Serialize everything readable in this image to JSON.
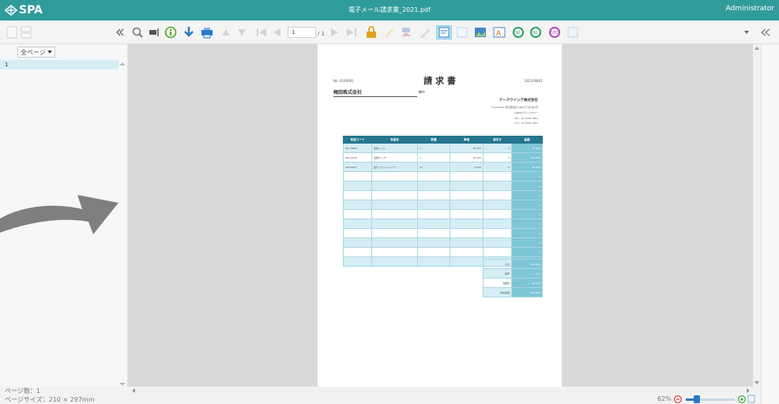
{
  "app": {
    "logo_text": "SPA",
    "document_title": "電子メール請求書_2021.pdf",
    "user": "Administrator"
  },
  "toolbar": {
    "page_input": "1",
    "page_total": "/ 1"
  },
  "sidebar": {
    "page_select": "全ページ",
    "pages": [
      "1"
    ]
  },
  "status": {
    "page_count": "ページ数：1",
    "page_size": "ページサイズ：210 × 297mm",
    "zoom": "62%"
  },
  "invoice": {
    "number": "No. 0100001",
    "title": "請 求 書",
    "date": "2021/08/01",
    "customer": "梅田株式会社",
    "honorific": "御中",
    "company": "アークウイング株式会社",
    "address": "〒100-0022 東京都港区六本木3丁目2番1号",
    "building": "六本木グランドタワー",
    "tel": "TEL：03-5582-7861",
    "fax": "FAX：03-5582-7881",
    "headers": [
      "商品コード",
      "商品名",
      "数量",
      "単価",
      "値引き",
      "金額"
    ],
    "rows": [
      [
        "SN-23605",
        "電動ドリル",
        "1",
        "35,000",
        "0",
        "35,000"
      ],
      [
        "SN-23345",
        "電動カッター",
        "3",
        "35,000",
        "0",
        "105,000"
      ],
      [
        "SN-00007",
        "電気ブラシハンドラー",
        "10",
        "6,000",
        "0",
        "60,000"
      ]
    ],
    "empty_amount": "0",
    "summary": [
      {
        "label": "小計",
        "value": "200,000"
      },
      {
        "label": "税率",
        "value": "10%"
      },
      {
        "label": "消費税",
        "value": "20,000"
      },
      {
        "label": "請求金額",
        "value": "220,000"
      }
    ]
  }
}
